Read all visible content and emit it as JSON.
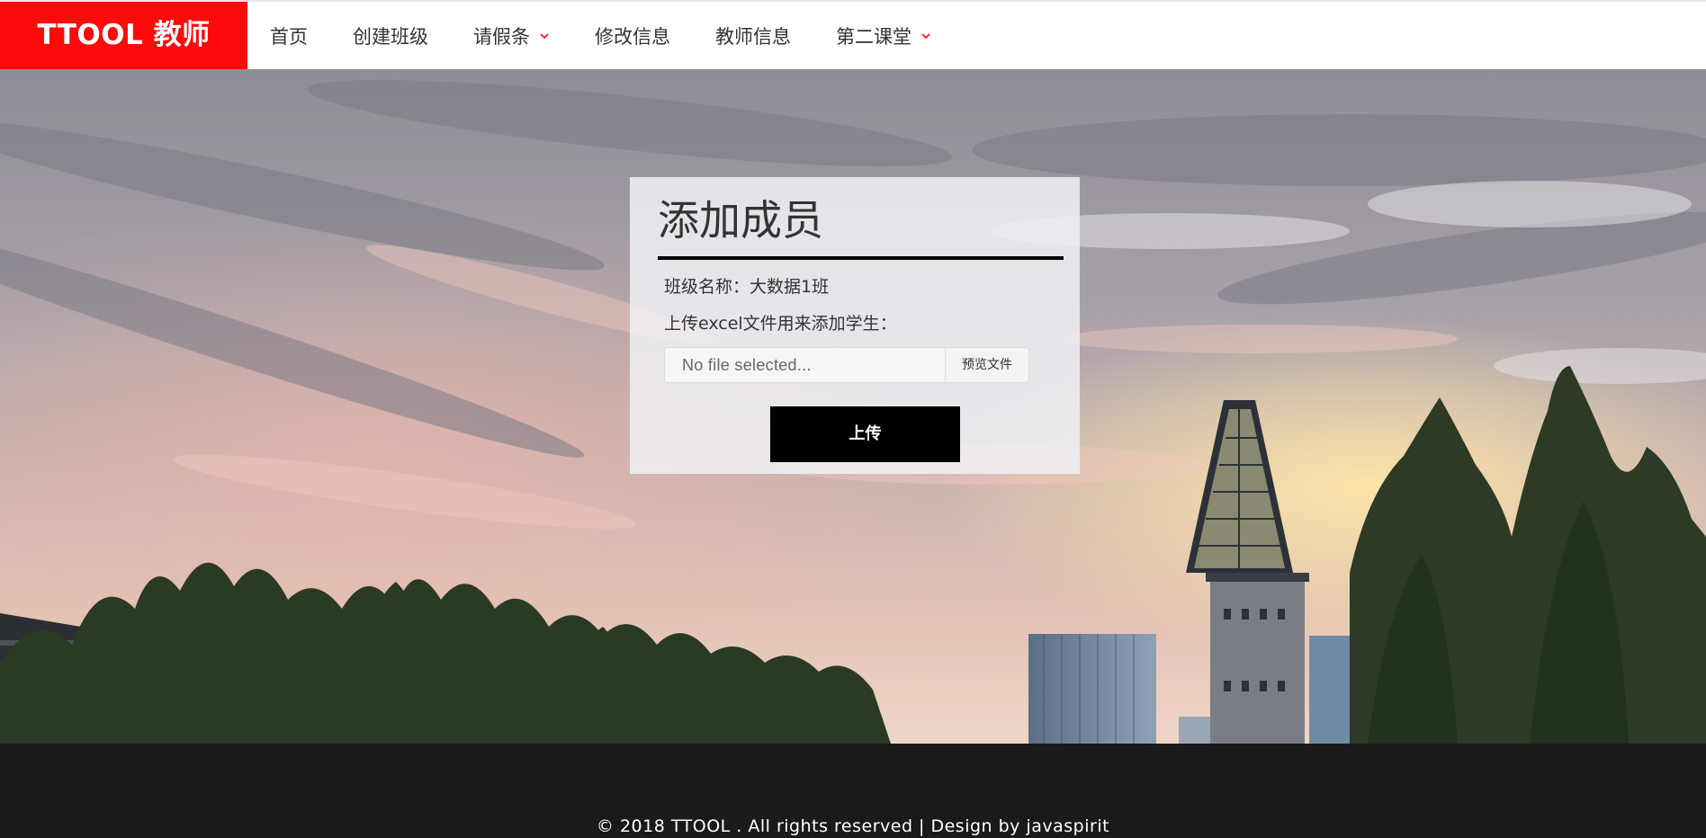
{
  "brand": {
    "title": "TTOOL 教师",
    "color": "#ff0a0a"
  },
  "nav": {
    "items": [
      {
        "label": "首页",
        "has_dropdown": false
      },
      {
        "label": "创建班级",
        "has_dropdown": false
      },
      {
        "label": "请假条",
        "has_dropdown": true
      },
      {
        "label": "修改信息",
        "has_dropdown": false
      },
      {
        "label": "教师信息",
        "has_dropdown": false
      },
      {
        "label": "第二课堂",
        "has_dropdown": true
      }
    ],
    "dropdown_icon": "chevron-down-icon",
    "dropdown_icon_color": "#ff0a0a"
  },
  "form": {
    "title": "添加成员",
    "class_name_text": "班级名称：大数据1班",
    "upload_prompt": "上传excel文件用来添加学生：",
    "file_placeholder": "No file selected...",
    "browse_label": "预览文件",
    "submit_label": "上传"
  },
  "footer": {
    "copyright": "© 2018 TTOOL . All rights reserved | Design by javaspirit",
    "background": "#1a1a1a"
  }
}
